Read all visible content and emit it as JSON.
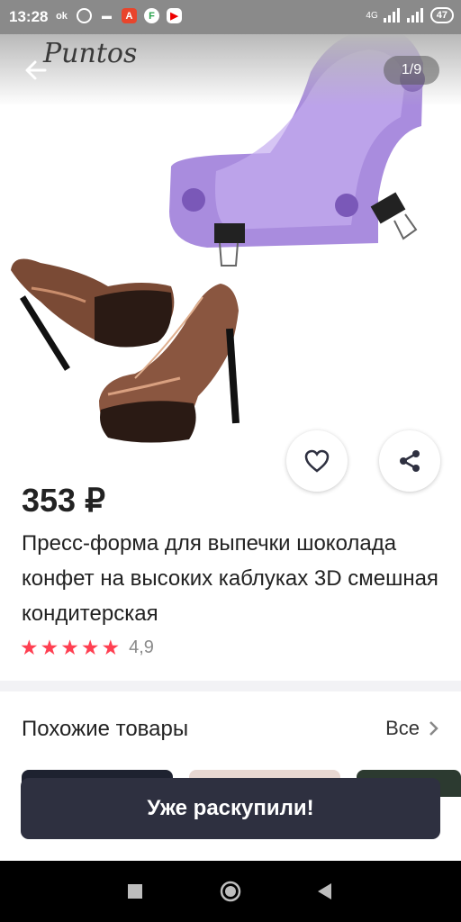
{
  "status_bar": {
    "time": "13:28",
    "network_label": "4G",
    "battery": "47"
  },
  "header": {
    "brand": "Puntos",
    "page_counter": "1/9"
  },
  "product": {
    "price": "353 ₽",
    "title": "Пресс-форма для выпечки шоколада конфет на высоких каблуках 3D смешная кондитерская",
    "rating_value": "4,9",
    "rating_stars": 5
  },
  "similar": {
    "title": "Похожие товары",
    "all_link": "Все"
  },
  "action": {
    "sold_out_label": "Уже раскупили!"
  },
  "colors": {
    "accent_star": "#ff3f51",
    "button_dark": "#2e3040",
    "mold_purple": "#9a78d8",
    "chocolate": "#7a4a35"
  },
  "icons": [
    "back-arrow-icon",
    "heart-icon",
    "share-icon",
    "chevron-right-icon",
    "star-icon",
    "stop-icon",
    "home-icon",
    "back-triangle-icon"
  ]
}
